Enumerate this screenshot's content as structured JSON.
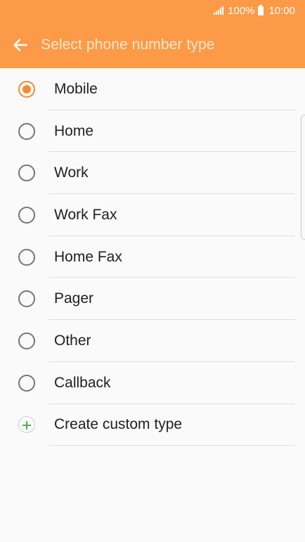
{
  "status_bar": {
    "battery_percent": "100%",
    "time": "10:00",
    "signal_icon": "signal-icon",
    "battery_icon": "battery-icon"
  },
  "header": {
    "title": "Select phone number type",
    "back_icon": "arrow-left-icon",
    "color": "#fd9a47"
  },
  "list": {
    "items": [
      {
        "label": "Mobile",
        "selected": true
      },
      {
        "label": "Home",
        "selected": false
      },
      {
        "label": "Work",
        "selected": false
      },
      {
        "label": "Work Fax",
        "selected": false
      },
      {
        "label": "Home Fax",
        "selected": false
      },
      {
        "label": "Pager",
        "selected": false
      },
      {
        "label": "Other",
        "selected": false
      },
      {
        "label": "Callback",
        "selected": false
      }
    ],
    "create_custom": {
      "label": "Create custom type",
      "icon": "plus-icon"
    },
    "accent_color": "#f58a33"
  }
}
